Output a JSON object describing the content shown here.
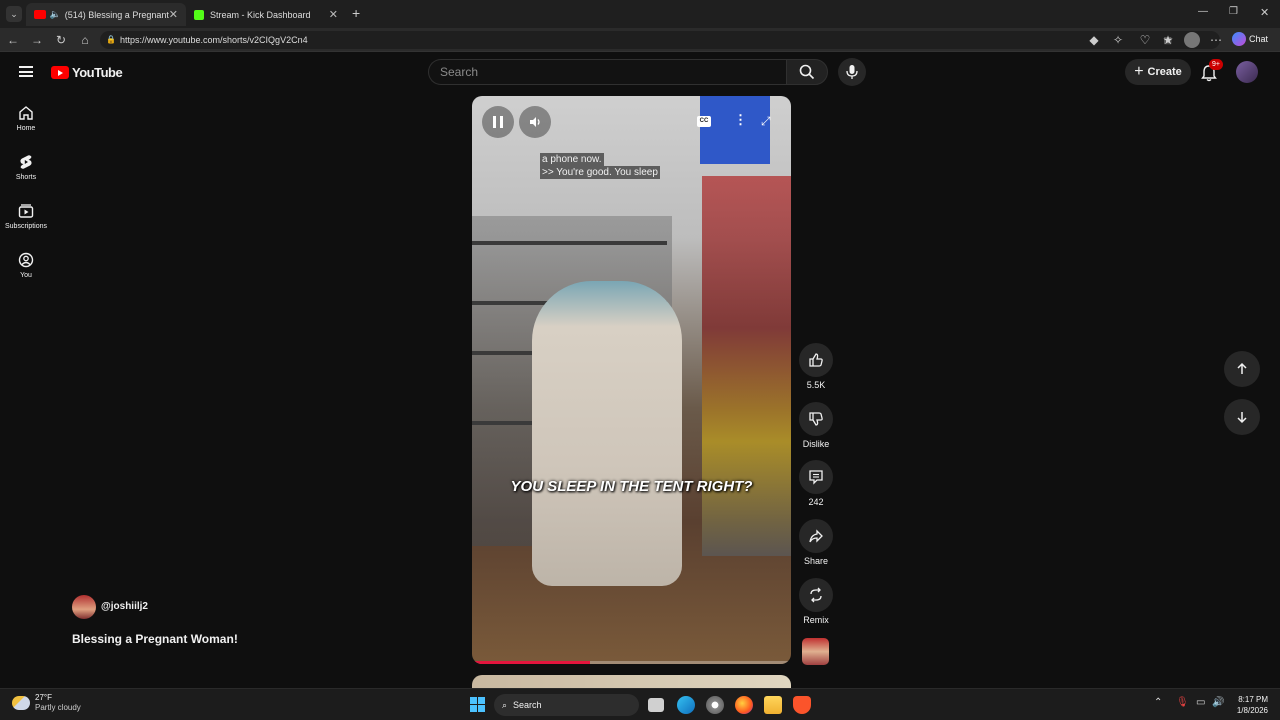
{
  "browser": {
    "tabs": [
      {
        "label": "(514) Blessing a Pregnant Wo",
        "active": true
      },
      {
        "label": "Stream - Kick Dashboard",
        "active": false
      }
    ],
    "url": "https://www.youtube.com/shorts/v2CIQgV2Cn4",
    "chat_label": "Chat"
  },
  "youtube": {
    "logo_text": "YouTube",
    "search": {
      "placeholder": "Search"
    },
    "create_label": "Create",
    "notifications_badge": "9+",
    "sidebar": [
      {
        "label": "Home",
        "icon": "home-icon"
      },
      {
        "label": "Shorts",
        "icon": "shorts-icon"
      },
      {
        "label": "Subscriptions",
        "icon": "subscriptions-icon"
      },
      {
        "label": "You",
        "icon": "you-icon"
      }
    ]
  },
  "short": {
    "caption_lines": [
      "a phone now.",
      ">> You're good. You sleep"
    ],
    "subtitle": "YOU SLEEP IN THE TENT RIGHT?",
    "channel": "@joshiilj2",
    "title": "Blessing a Pregnant Woman!",
    "progress": 0.37,
    "actions": {
      "like_count": "5.5K",
      "dislike_label": "Dislike",
      "comment_count": "242",
      "share_label": "Share",
      "remix_label": "Remix"
    },
    "cc_label": "CC"
  },
  "taskbar": {
    "weather_temp": "27°F",
    "weather_desc": "Partly cloudy",
    "search_label": "Search",
    "time": "8:17 PM",
    "date": "1/8/2026"
  },
  "colors": {
    "youtube_red": "#ff0000",
    "progress_red": "#e3153d",
    "background": "#0f0f0f"
  }
}
